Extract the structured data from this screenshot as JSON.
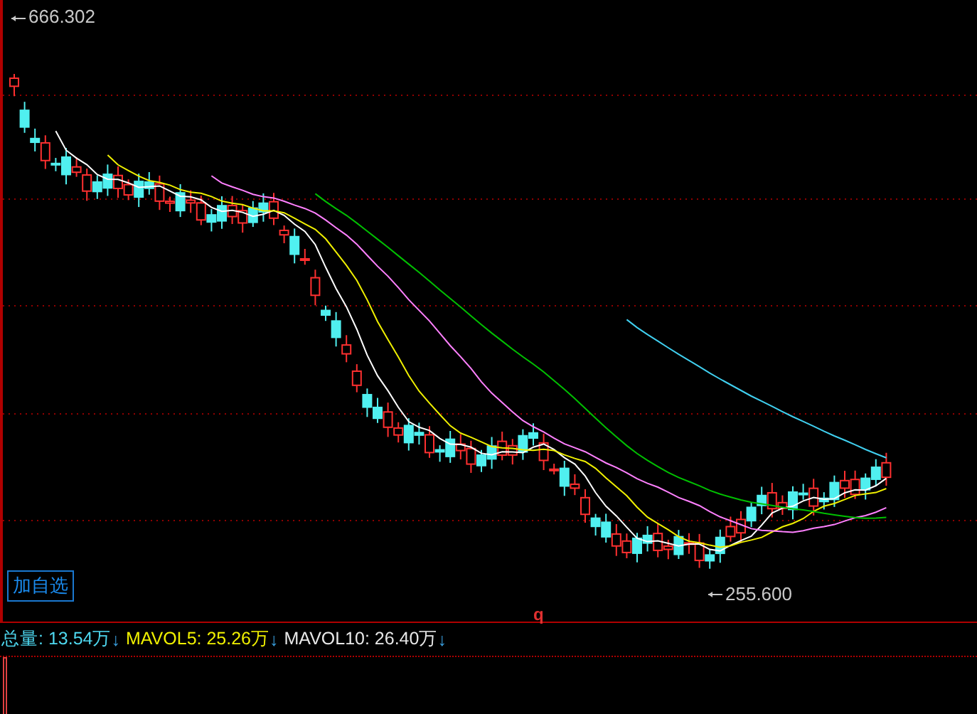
{
  "price_chart": {
    "high_label": "666.302",
    "low_label": "255.600",
    "add_watchlist_button": "加自选",
    "marker": "q"
  },
  "volume_indicators": [
    {
      "text": "总量: 13.54万",
      "arrow": "↓",
      "color": "#4ed8f0"
    },
    {
      "text": "MAVOL5: 25.26万",
      "arrow": "↓",
      "color": "#f0f000"
    },
    {
      "text": "MAVOL10: 26.40万",
      "arrow": "↓",
      "color": "#e8e8e8"
    }
  ]
}
